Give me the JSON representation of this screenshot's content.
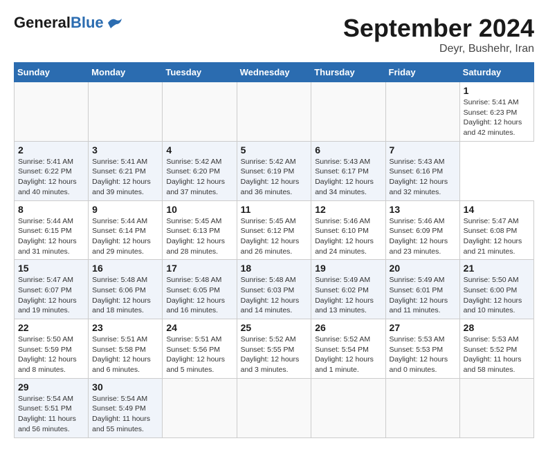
{
  "header": {
    "logo_general": "General",
    "logo_blue": "Blue",
    "title": "September 2024",
    "location": "Deyr, Bushehr, Iran"
  },
  "calendar": {
    "days_of_week": [
      "Sunday",
      "Monday",
      "Tuesday",
      "Wednesday",
      "Thursday",
      "Friday",
      "Saturday"
    ],
    "weeks": [
      [
        null,
        null,
        null,
        null,
        null,
        null,
        {
          "day": 1,
          "sunrise": "5:41 AM",
          "sunset": "6:23 PM",
          "daylight": "12 hours and 42 minutes."
        }
      ],
      [
        {
          "day": 2,
          "sunrise": "5:41 AM",
          "sunset": "6:22 PM",
          "daylight": "12 hours and 40 minutes."
        },
        {
          "day": 3,
          "sunrise": "5:41 AM",
          "sunset": "6:21 PM",
          "daylight": "12 hours and 39 minutes."
        },
        {
          "day": 4,
          "sunrise": "5:42 AM",
          "sunset": "6:20 PM",
          "daylight": "12 hours and 37 minutes."
        },
        {
          "day": 5,
          "sunrise": "5:42 AM",
          "sunset": "6:19 PM",
          "daylight": "12 hours and 36 minutes."
        },
        {
          "day": 6,
          "sunrise": "5:43 AM",
          "sunset": "6:17 PM",
          "daylight": "12 hours and 34 minutes."
        },
        {
          "day": 7,
          "sunrise": "5:43 AM",
          "sunset": "6:16 PM",
          "daylight": "12 hours and 32 minutes."
        }
      ],
      [
        {
          "day": 8,
          "sunrise": "5:44 AM",
          "sunset": "6:15 PM",
          "daylight": "12 hours and 31 minutes."
        },
        {
          "day": 9,
          "sunrise": "5:44 AM",
          "sunset": "6:14 PM",
          "daylight": "12 hours and 29 minutes."
        },
        {
          "day": 10,
          "sunrise": "5:45 AM",
          "sunset": "6:13 PM",
          "daylight": "12 hours and 28 minutes."
        },
        {
          "day": 11,
          "sunrise": "5:45 AM",
          "sunset": "6:12 PM",
          "daylight": "12 hours and 26 minutes."
        },
        {
          "day": 12,
          "sunrise": "5:46 AM",
          "sunset": "6:10 PM",
          "daylight": "12 hours and 24 minutes."
        },
        {
          "day": 13,
          "sunrise": "5:46 AM",
          "sunset": "6:09 PM",
          "daylight": "12 hours and 23 minutes."
        },
        {
          "day": 14,
          "sunrise": "5:47 AM",
          "sunset": "6:08 PM",
          "daylight": "12 hours and 21 minutes."
        }
      ],
      [
        {
          "day": 15,
          "sunrise": "5:47 AM",
          "sunset": "6:07 PM",
          "daylight": "12 hours and 19 minutes."
        },
        {
          "day": 16,
          "sunrise": "5:48 AM",
          "sunset": "6:06 PM",
          "daylight": "12 hours and 18 minutes."
        },
        {
          "day": 17,
          "sunrise": "5:48 AM",
          "sunset": "6:05 PM",
          "daylight": "12 hours and 16 minutes."
        },
        {
          "day": 18,
          "sunrise": "5:48 AM",
          "sunset": "6:03 PM",
          "daylight": "12 hours and 14 minutes."
        },
        {
          "day": 19,
          "sunrise": "5:49 AM",
          "sunset": "6:02 PM",
          "daylight": "12 hours and 13 minutes."
        },
        {
          "day": 20,
          "sunrise": "5:49 AM",
          "sunset": "6:01 PM",
          "daylight": "12 hours and 11 minutes."
        },
        {
          "day": 21,
          "sunrise": "5:50 AM",
          "sunset": "6:00 PM",
          "daylight": "12 hours and 10 minutes."
        }
      ],
      [
        {
          "day": 22,
          "sunrise": "5:50 AM",
          "sunset": "5:59 PM",
          "daylight": "12 hours and 8 minutes."
        },
        {
          "day": 23,
          "sunrise": "5:51 AM",
          "sunset": "5:58 PM",
          "daylight": "12 hours and 6 minutes."
        },
        {
          "day": 24,
          "sunrise": "5:51 AM",
          "sunset": "5:56 PM",
          "daylight": "12 hours and 5 minutes."
        },
        {
          "day": 25,
          "sunrise": "5:52 AM",
          "sunset": "5:55 PM",
          "daylight": "12 hours and 3 minutes."
        },
        {
          "day": 26,
          "sunrise": "5:52 AM",
          "sunset": "5:54 PM",
          "daylight": "12 hours and 1 minute."
        },
        {
          "day": 27,
          "sunrise": "5:53 AM",
          "sunset": "5:53 PM",
          "daylight": "12 hours and 0 minutes."
        },
        {
          "day": 28,
          "sunrise": "5:53 AM",
          "sunset": "5:52 PM",
          "daylight": "11 hours and 58 minutes."
        }
      ],
      [
        {
          "day": 29,
          "sunrise": "5:54 AM",
          "sunset": "5:51 PM",
          "daylight": "11 hours and 56 minutes."
        },
        {
          "day": 30,
          "sunrise": "5:54 AM",
          "sunset": "5:49 PM",
          "daylight": "11 hours and 55 minutes."
        },
        null,
        null,
        null,
        null,
        null
      ]
    ]
  }
}
